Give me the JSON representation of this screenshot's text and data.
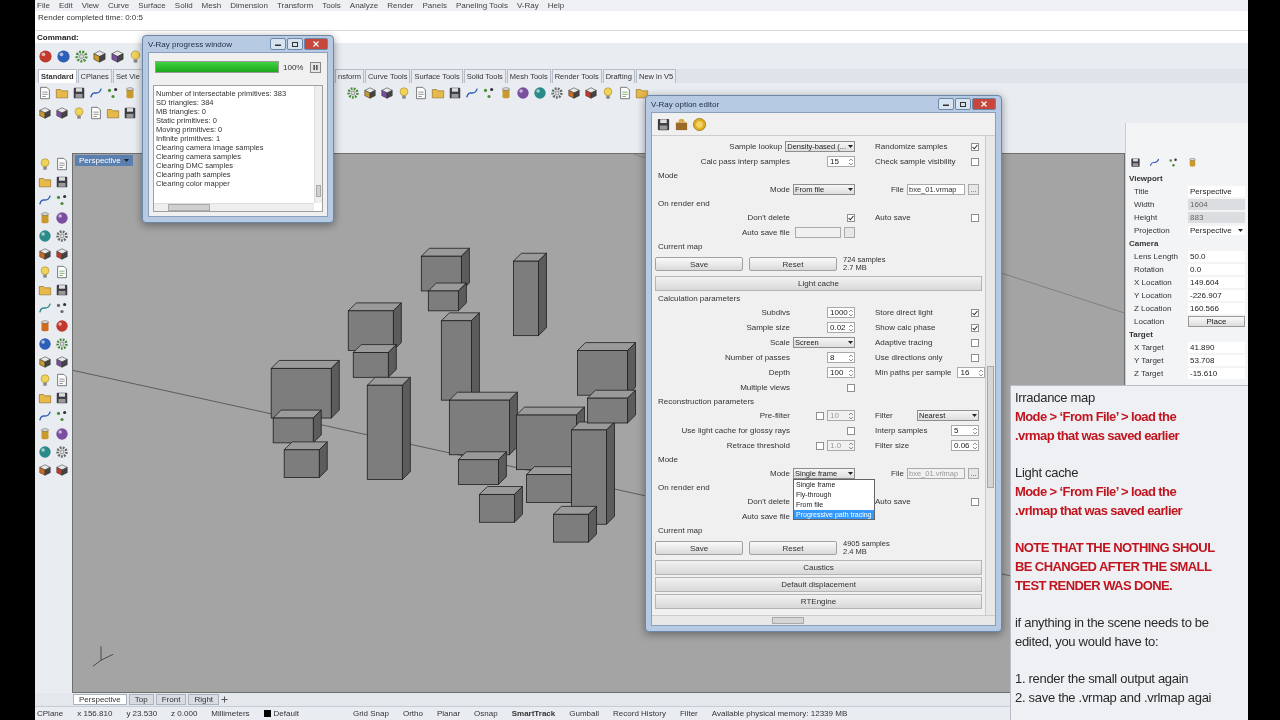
{
  "menu_bar": [
    "File",
    "Edit",
    "View",
    "Curve",
    "Surface",
    "Solid",
    "Mesh",
    "Dimension",
    "Transform",
    "Tools",
    "Analyze",
    "Render",
    "Panels",
    "Paneling Tools",
    "V-Ray",
    "Help"
  ],
  "command_history": [
    "Render completed time: 0:0:5"
  ],
  "command": {
    "label": "Command:"
  },
  "toolbar_tabs": [
    {
      "label": "Standard",
      "selected": true
    },
    {
      "label": "CPlanes",
      "selected": false
    },
    {
      "label": "Set Vie",
      "selected": false
    },
    {
      "label": "nsform",
      "selected": false
    },
    {
      "label": "Curve Tools",
      "selected": false
    },
    {
      "label": "Surface Tools",
      "selected": false
    },
    {
      "label": "Solid Tools",
      "selected": false
    },
    {
      "label": "Mesh Tools",
      "selected": false
    },
    {
      "label": "Render Tools",
      "selected": false
    },
    {
      "label": "Drafting",
      "selected": false
    },
    {
      "label": "New in V5",
      "selected": false
    }
  ],
  "viewport": {
    "title": "Perspective"
  },
  "properties": {
    "groups": [
      {
        "title": "Viewport",
        "rows": [
          {
            "label": "Title",
            "value": "Perspective",
            "kind": "text"
          },
          {
            "label": "Width",
            "value": "1604",
            "kind": "disabled"
          },
          {
            "label": "Height",
            "value": "883",
            "kind": "disabled"
          },
          {
            "label": "Projection",
            "value": "Perspective",
            "kind": "combo"
          }
        ]
      },
      {
        "title": "Camera",
        "rows": [
          {
            "label": "Lens Length",
            "value": "50.0",
            "kind": "text"
          },
          {
            "label": "Rotation",
            "value": "0.0",
            "kind": "text"
          },
          {
            "label": "X Location",
            "value": "149.604",
            "kind": "text"
          },
          {
            "label": "Y Location",
            "value": "-226.907",
            "kind": "text"
          },
          {
            "label": "Z Location",
            "value": "160.566",
            "kind": "text"
          },
          {
            "label": "Location",
            "value": "Place",
            "kind": "button"
          }
        ]
      },
      {
        "title": "Target",
        "rows": [
          {
            "label": "X Target",
            "value": "41.890",
            "kind": "text"
          },
          {
            "label": "Y Target",
            "value": "53.708",
            "kind": "text"
          },
          {
            "label": "Z Target",
            "value": "-15.610",
            "kind": "text"
          }
        ]
      }
    ]
  },
  "progress_window": {
    "title": "V-Ray progress window",
    "level": 1,
    "percent": "100%",
    "log": [
      "Number of intersectable primitives: 383",
      "SD triangles: 384",
      "MB triangles: 0",
      "Static primitives: 0",
      "Moving primitives: 0",
      "Infinite primitives: 1",
      "Clearing camera image samples",
      "Clearing camera samples",
      "Clearing DMC samples",
      "Clearing path samples",
      "Clearing color mapper"
    ]
  },
  "option_editor": {
    "title": "V-Ray option editor",
    "rows": [
      {
        "kind": "fields",
        "left": {
          "label": "Sample lookup",
          "control": {
            "kind": "combo",
            "value": "Density-based (..."
          }
        },
        "right": {
          "label": "Randomize samples",
          "control": {
            "kind": "check",
            "checked": true
          }
        }
      },
      {
        "kind": "fields",
        "left": {
          "label": "Calc pass interp samples",
          "control": {
            "kind": "spin",
            "value": "15"
          }
        },
        "right": {
          "label": "Check sample visibility",
          "control": {
            "kind": "check",
            "checked": false
          }
        }
      },
      {
        "kind": "group",
        "label": "Mode"
      },
      {
        "kind": "fields",
        "left": {
          "label": "Mode",
          "control": {
            "kind": "combo",
            "value": "From file"
          }
        },
        "right": {
          "label": "File",
          "control": {
            "kind": "file",
            "value": "bxe_01.vrmap",
            "browse": "...",
            "disabled": false
          }
        }
      },
      {
        "kind": "group",
        "label": "On render end"
      },
      {
        "kind": "fields",
        "left": {
          "label": "Don't delete",
          "control": {
            "kind": "check",
            "checked": true
          }
        },
        "right": {
          "label": "Auto save",
          "control": {
            "kind": "check",
            "checked": false
          }
        }
      },
      {
        "kind": "fields",
        "left": {
          "label": "Auto save file",
          "control": {
            "kind": "file",
            "disabled": true
          }
        }
      },
      {
        "kind": "group",
        "label": "Current map"
      },
      {
        "kind": "map",
        "save": "Save",
        "reset": "Reset",
        "info": [
          "724 samples",
          "2.7 MB"
        ]
      },
      {
        "kind": "rollout",
        "label": "Light cache"
      },
      {
        "kind": "group",
        "label": "Calculation parameters"
      },
      {
        "kind": "fields",
        "left": {
          "label": "Subdivs",
          "control": {
            "kind": "spin",
            "value": "1000"
          }
        },
        "right": {
          "label": "Store direct light",
          "control": {
            "kind": "check",
            "checked": true
          }
        }
      },
      {
        "kind": "fields",
        "left": {
          "label": "Sample size",
          "control": {
            "kind": "spin",
            "value": "0.02"
          }
        },
        "right": {
          "label": "Show calc phase",
          "control": {
            "kind": "check",
            "checked": true
          }
        }
      },
      {
        "kind": "fields",
        "left": {
          "label": "Scale",
          "control": {
            "kind": "combo",
            "value": "Screen"
          }
        },
        "right": {
          "label": "Adaptive tracing",
          "control": {
            "kind": "check",
            "checked": false
          }
        }
      },
      {
        "kind": "fields",
        "left": {
          "label": "Number of passes",
          "control": {
            "kind": "spin",
            "value": "8"
          }
        },
        "right": {
          "label": "Use directions only",
          "control": {
            "kind": "check",
            "checked": false
          }
        }
      },
      {
        "kind": "fields",
        "left": {
          "label": "Depth",
          "control": {
            "kind": "spin",
            "value": "100"
          }
        },
        "right": {
          "label": "Min paths per sample",
          "control": {
            "kind": "spin",
            "value": "16"
          }
        }
      },
      {
        "kind": "fields",
        "left": {
          "label": "Multiple views",
          "control": {
            "kind": "check",
            "checked": false
          }
        }
      },
      {
        "kind": "group",
        "label": "Reconstruction parameters"
      },
      {
        "kind": "fields",
        "left": {
          "label": "Pre-filter",
          "control": {
            "kind": "checkspin",
            "checked": false,
            "value": "10"
          }
        },
        "right": {
          "label": "Filter",
          "control": {
            "kind": "combo",
            "value": "Nearest"
          }
        }
      },
      {
        "kind": "fields",
        "left": {
          "label": "Use light cache for glossy rays",
          "control": {
            "kind": "check",
            "checked": false
          }
        },
        "right": {
          "label": "Interp samples",
          "control": {
            "kind": "spin",
            "value": "5"
          }
        }
      },
      {
        "kind": "fields",
        "left": {
          "label": "Retrace threshold",
          "control": {
            "kind": "checkspin",
            "checked": false,
            "value": "1.0"
          }
        },
        "right": {
          "label": "Filter size",
          "control": {
            "kind": "spin",
            "value": "0.06"
          }
        }
      },
      {
        "kind": "group",
        "label": "Mode"
      },
      {
        "kind": "fields",
        "left": {
          "label": "Mode",
          "control": {
            "kind": "combo",
            "value": "Single frame",
            "options": [
              {
                "label": "Single frame",
                "highlighted": false
              },
              {
                "label": "Fly-through",
                "highlighted": false
              },
              {
                "label": "From file",
                "highlighted": false
              },
              {
                "label": "Progressive path tracing",
                "highlighted": true
              }
            ]
          }
        },
        "right": {
          "label": "File",
          "control": {
            "kind": "file",
            "value": "bxe_01.vrlmap",
            "browse": "...",
            "disabled": true
          }
        }
      },
      {
        "kind": "group",
        "label": "On render end"
      },
      {
        "kind": "fields",
        "left": {
          "label": "Don't delete"
        },
        "right": {
          "label": "Auto save",
          "control": {
            "kind": "check",
            "checked": false
          }
        }
      },
      {
        "kind": "fields",
        "left": {
          "label": "Auto save file"
        }
      },
      {
        "kind": "group",
        "label": "Current map"
      },
      {
        "kind": "map",
        "save": "Save",
        "reset": "Reset",
        "info": [
          "4905 samples",
          "2.4 MB"
        ]
      },
      {
        "kind": "rollout",
        "label": "Caustics"
      },
      {
        "kind": "rollout",
        "label": "Default displacement"
      },
      {
        "kind": "rollout",
        "label": "RTEngine"
      }
    ]
  },
  "notes": [
    {
      "kind": "plain",
      "lines": [
        "Irradance map"
      ]
    },
    {
      "kind": "emphasis",
      "lines": [
        "Mode > ‘From File’ > load the",
        ".vrmap that was saved earlier"
      ]
    },
    {
      "kind": "plain",
      "lines": [
        "Light cache"
      ]
    },
    {
      "kind": "emphasis",
      "lines": [
        "Mode > ‘From File’ > load the",
        ".vrlmap that was saved earlier"
      ]
    },
    {
      "kind": "emphasis",
      "lines": [
        "NOTE THAT THE NOTHING SHOUL",
        "BE CHANGED AFTER THE SMALL",
        "TEST RENDER WAS DONE."
      ]
    },
    {
      "kind": "plain",
      "lines": [
        "if anything in the scene needs to be",
        "edited, you would have to:"
      ]
    },
    {
      "kind": "plain",
      "lines": [
        "1. render the small output again",
        "2. save the .vrmap and .vrlmap agai"
      ]
    }
  ],
  "viewport_tabs": [
    {
      "label": "Perspective",
      "selected": true
    },
    {
      "label": "Top",
      "selected": false
    },
    {
      "label": "Front",
      "selected": false
    },
    {
      "label": "Right",
      "selected": false
    }
  ],
  "status_bar": [
    {
      "kind": "text",
      "text": "CPlane"
    },
    {
      "kind": "text",
      "text": "x 156.810"
    },
    {
      "kind": "text",
      "text": "y 23.530"
    },
    {
      "kind": "text",
      "text": "z 0.000"
    },
    {
      "kind": "text",
      "text": "Millimeters"
    },
    {
      "kind": "layer",
      "text": "Default"
    },
    {
      "kind": "toggle",
      "text": "Grid Snap",
      "on": false
    },
    {
      "kind": "toggle",
      "text": "Ortho",
      "on": false
    },
    {
      "kind": "toggle",
      "text": "Planar",
      "on": false
    },
    {
      "kind": "toggle",
      "text": "Osnap",
      "on": false
    },
    {
      "kind": "toggle",
      "text": "SmartTrack",
      "on": true
    },
    {
      "kind": "toggle",
      "text": "Gumball",
      "on": false
    },
    {
      "kind": "toggle",
      "text": "Record History",
      "on": false
    },
    {
      "kind": "toggle",
      "text": "Filter",
      "on": false
    },
    {
      "kind": "text",
      "text": "Available physical memory: 12339 MB"
    }
  ]
}
